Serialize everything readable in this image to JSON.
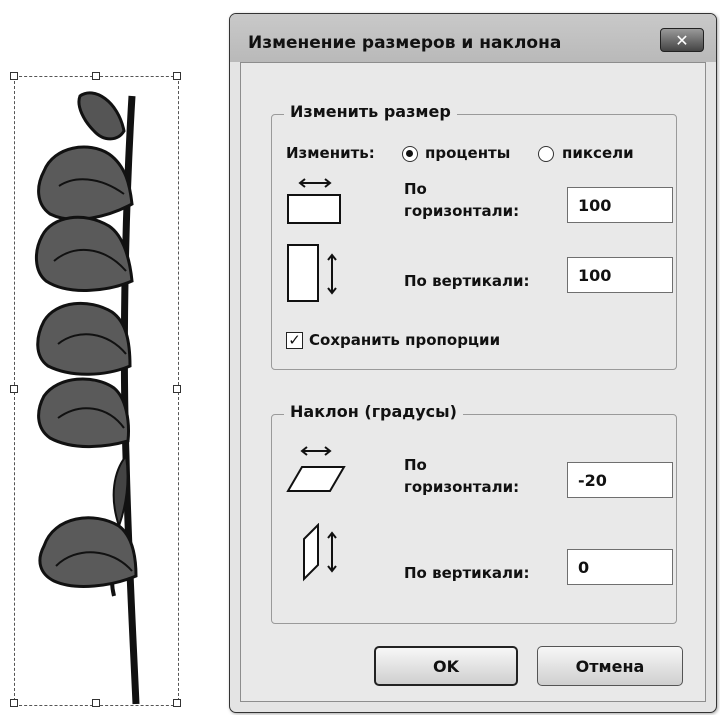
{
  "dialog": {
    "title": "Изменение размеров и наклона",
    "close_glyph": "✕"
  },
  "resize": {
    "group_title": "Изменить размер",
    "by_label": "Изменить:",
    "option_percent": "проценты",
    "option_pixels": "пиксели",
    "selected": "percent",
    "horizontal_label_line1": "По",
    "horizontal_label_line2": "горизонтали:",
    "horizontal_value": "100",
    "vertical_label": "По вертикали:",
    "vertical_value": "100",
    "keep_ratio_label": "Сохранить пропорции",
    "keep_ratio_checked": true,
    "checkmark": "✓"
  },
  "skew": {
    "group_title": "Наклон (градусы)",
    "horizontal_label_line1": "По",
    "horizontal_label_line2": "горизонтали:",
    "horizontal_value": "-20",
    "vertical_label": "По вертикали:",
    "vertical_value": "0"
  },
  "buttons": {
    "ok": "OK",
    "cancel": "Отмена"
  },
  "icons": {
    "resize_horizontal": "resize-horizontal-icon",
    "resize_vertical": "resize-vertical-icon",
    "skew_horizontal": "skew-horizontal-icon",
    "skew_vertical": "skew-vertical-icon",
    "close": "close-icon"
  }
}
